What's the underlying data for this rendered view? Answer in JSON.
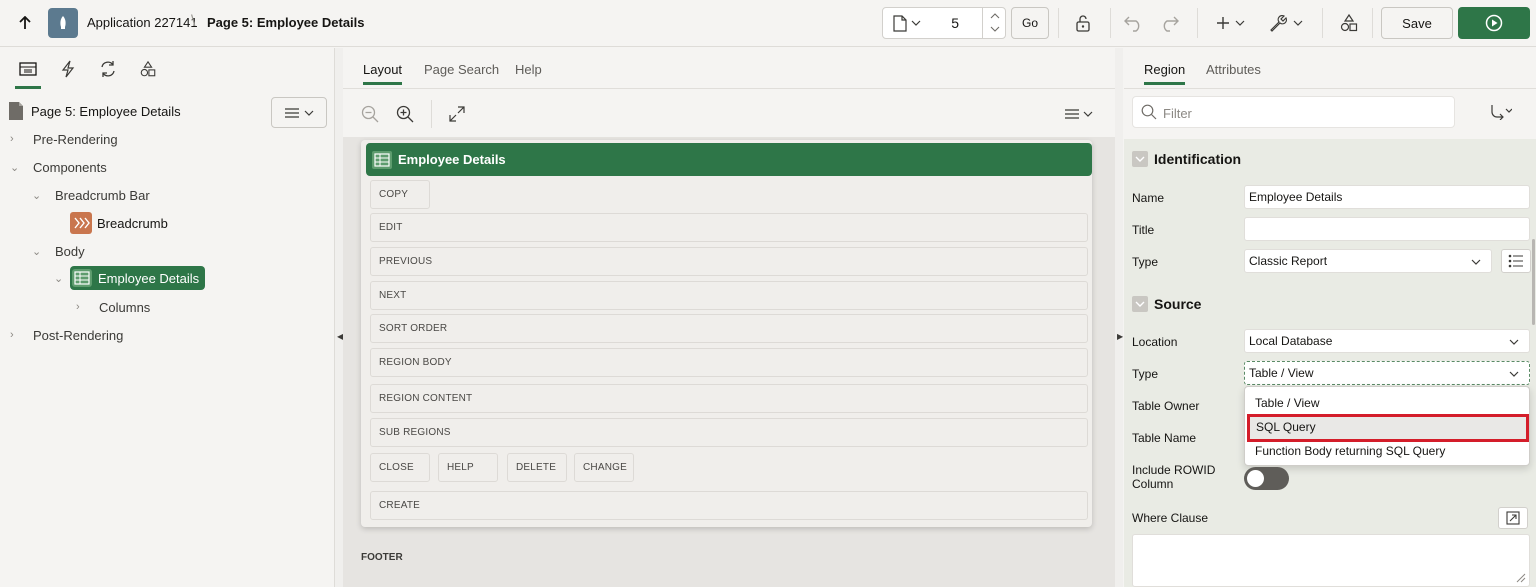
{
  "app": {
    "name": "Application 227141",
    "breadcrumb_separator": "\\",
    "page_title": "Page 5: Employee Details"
  },
  "toolbar": {
    "page_number": "5",
    "go_label": "Go",
    "save_label": "Save",
    "accent_color": "#2e7648"
  },
  "left_pane": {
    "tabs": [
      "rendering-icon",
      "dynamic-actions-icon",
      "processing-icon",
      "shared-components-icon"
    ],
    "tree": {
      "root": "Page 5: Employee Details",
      "pre_rendering": "Pre-Rendering",
      "components": "Components",
      "breadcrumb_bar": "Breadcrumb Bar",
      "breadcrumb": "Breadcrumb",
      "body": "Body",
      "employee_details": "Employee Details",
      "columns": "Columns",
      "post_rendering": "Post-Rendering"
    }
  },
  "center_pane": {
    "tabs": {
      "layout": "Layout",
      "page_search": "Page Search",
      "help": "Help"
    },
    "region_title": "Employee Details",
    "slots": {
      "copy": "COPY",
      "edit": "EDIT",
      "previous": "PREVIOUS",
      "next": "NEXT",
      "sort_order": "SORT ORDER",
      "region_body": "REGION BODY",
      "region_content": "REGION CONTENT",
      "sub_regions": "SUB REGIONS",
      "close": "CLOSE",
      "help": "HELP",
      "delete": "DELETE",
      "change": "CHANGE",
      "create": "CREATE"
    },
    "footer": "FOOTER"
  },
  "right_pane": {
    "tabs": {
      "region": "Region",
      "attributes": "Attributes"
    },
    "filter_placeholder": "Filter",
    "identification": {
      "header": "Identification",
      "name_label": "Name",
      "name_value": "Employee Details",
      "title_label": "Title",
      "title_value": "",
      "type_label": "Type",
      "type_value": "Classic Report"
    },
    "source": {
      "header": "Source",
      "location_label": "Location",
      "location_value": "Local Database",
      "type_label": "Type",
      "type_value": "Table / View",
      "table_owner_label": "Table Owner",
      "table_name_label": "Table Name",
      "include_rowid_label_line1": "Include ROWID",
      "include_rowid_label_line2": "Column",
      "include_rowid_on": false,
      "where_clause_label": "Where Clause"
    },
    "dropdown": {
      "options": [
        "Table / View",
        "SQL Query",
        "Function Body returning SQL Query"
      ],
      "highlighted": "SQL Query"
    }
  }
}
